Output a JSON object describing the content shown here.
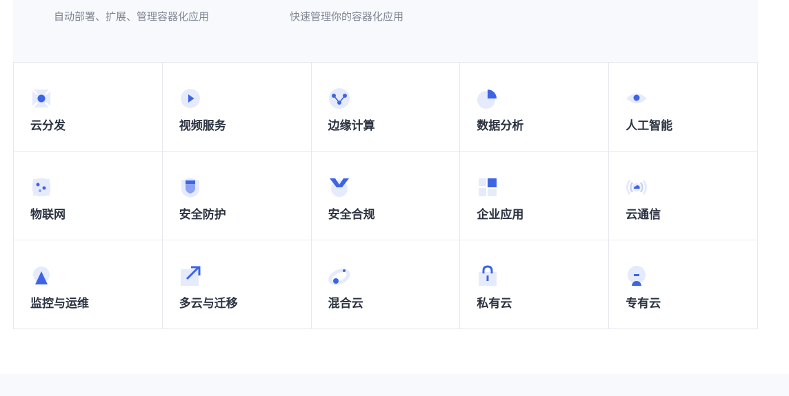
{
  "top": {
    "subtitle_left": "自动部署、扩展、管理容器化应用",
    "subtitle_right": "快速管理你的容器化应用"
  },
  "colors": {
    "accent": "#3d63e6",
    "icon_light": "#e6ebfb",
    "label": "#2b3240",
    "subtitle": "#7f8693",
    "border": "#e6e8ee"
  },
  "categories": [
    {
      "label": "云分发",
      "icon": "cdn-icon"
    },
    {
      "label": "视频服务",
      "icon": "video-play-icon"
    },
    {
      "label": "边缘计算",
      "icon": "edge-nodes-icon"
    },
    {
      "label": "数据分析",
      "icon": "pie-chart-icon"
    },
    {
      "label": "人工智能",
      "icon": "eye-icon"
    },
    {
      "label": "物联网",
      "icon": "iot-icon"
    },
    {
      "label": "安全防护",
      "icon": "shield-icon"
    },
    {
      "label": "安全合规",
      "icon": "badge-icon"
    },
    {
      "label": "企业应用",
      "icon": "grid-blocks-icon"
    },
    {
      "label": "云通信",
      "icon": "signal-cloud-icon"
    },
    {
      "label": "监控与运维",
      "icon": "monitor-triangle-icon"
    },
    {
      "label": "多云与迁移",
      "icon": "migrate-arrow-icon"
    },
    {
      "label": "混合云",
      "icon": "hybrid-orbit-icon"
    },
    {
      "label": "私有云",
      "icon": "lock-icon"
    },
    {
      "label": "专有云",
      "icon": "dedicated-cloud-icon"
    }
  ]
}
